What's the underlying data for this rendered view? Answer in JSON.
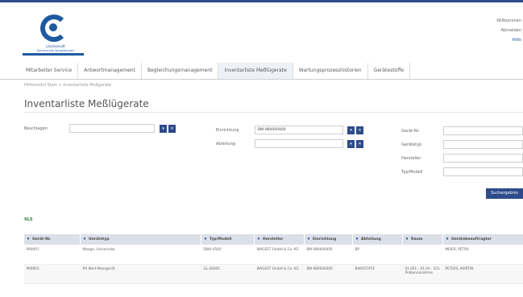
{
  "brand": {
    "line1": "Landeskraft",
    "line2": "Kommunale Verwaltungen"
  },
  "user": {
    "line1": "Willkommen",
    "line2": "Abmelden",
    "line3": "Hilfe"
  },
  "nav": [
    "Mitarbeiter Service",
    "Antwortmanagement",
    "Begleichungsmanagement",
    "Inventarliste Meßlügerate",
    "Wartungsprozesshistorien",
    "Gerätestoffe"
  ],
  "breadcrumb": "Hilfemodul Start > Inventarliste Meßgeräte",
  "page_title": "Inventarliste Meßlügerate",
  "filters": {
    "search_label": "Beschlagen",
    "search_value": "",
    "device_label": "Einrichtung",
    "device_value": "BW-980000400",
    "dept_label": "Abteilung",
    "dept_value": "",
    "serial_label": "Gerät-Nr.",
    "maker_label": "Gerätetyp",
    "producer_label": "Hersteller",
    "type_label": "Typ/Modell"
  },
  "buttons": {
    "pick": "▾",
    "clear": "✕",
    "search": "Suchergebnis"
  },
  "export_label": "XLS",
  "table": {
    "headers": [
      "Gerät-Nr.",
      "Gerätetyp",
      "Typ/Modell",
      "Hersteller",
      "Einrichtung",
      "Abteilung",
      "Raum",
      "Gerätebeauftragter"
    ],
    "rows": [
      [
        "990001",
        "Waage, Universalw.",
        "SWH-4560",
        "WAGEST GmbH & Co. KG",
        "BW-980000400",
        "BP",
        "",
        "MEIER, PETRA"
      ],
      [
        "990003",
        "PH Wert-Messgerät",
        "GL-28005",
        "WAGEST GmbH & Co. KG",
        "BW-980000400",
        "BAKSTOFFE",
        "01.001 - 01.04 - 101 Probenannahme",
        "PETERS, MARTIN"
      ]
    ]
  }
}
